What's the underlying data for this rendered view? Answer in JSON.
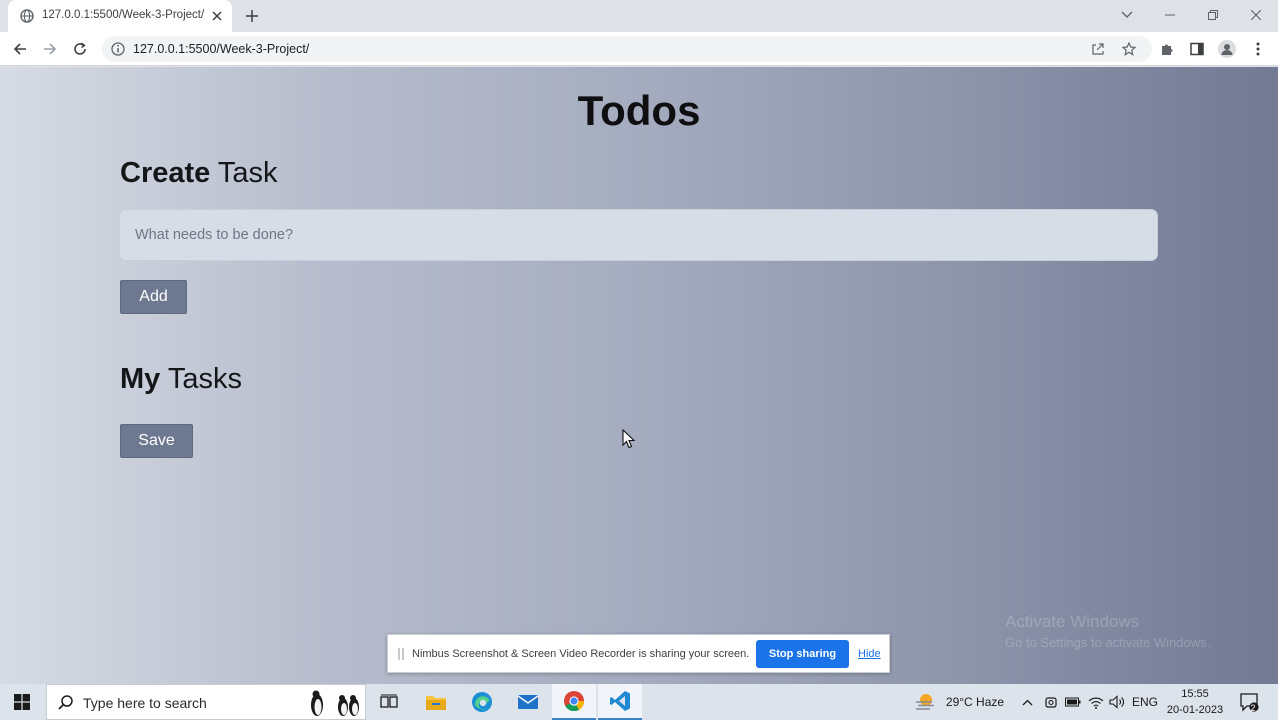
{
  "browser": {
    "tab_title": "127.0.0.1:5500/Week-3-Project/",
    "url": "127.0.0.1:5500/Week-3-Project/"
  },
  "page": {
    "title": "Todos",
    "create_heading_bold": "Create",
    "create_heading_light": "Task",
    "task_input_placeholder": "What needs to be done?",
    "add_label": "Add",
    "tasks_heading_bold": "My",
    "tasks_heading_light": "Tasks",
    "save_label": "Save"
  },
  "watermark": {
    "line1": "Activate Windows",
    "line2": "Go to Settings to activate Windows."
  },
  "share_bar": {
    "message": "Nimbus Screenshot & Screen Video Recorder is sharing your screen.",
    "stop_label": "Stop sharing",
    "hide_label": "Hide"
  },
  "taskbar": {
    "search_placeholder": "Type here to search",
    "weather": "29°C  Haze",
    "language": "ENG",
    "time": "15:55",
    "date": "20-01-2023",
    "notification_count": "2",
    "apps": [
      "task-view",
      "file-explorer",
      "edge",
      "mail",
      "chrome",
      "vscode"
    ]
  },
  "colors": {
    "button_bg": "#6e7890",
    "stop_sharing_bg": "#1a73e8",
    "gradient_start": "#d6dbe4",
    "gradient_end": "#727a94"
  }
}
